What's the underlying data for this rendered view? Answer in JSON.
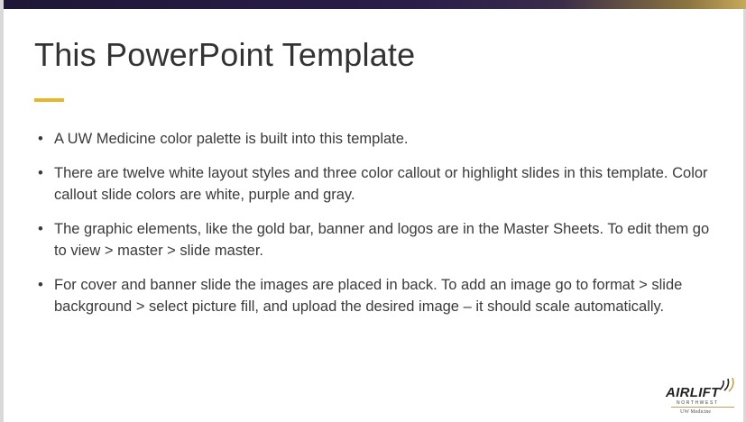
{
  "slide": {
    "title": "This PowerPoint Template",
    "bullet_char": "•",
    "bullets": [
      "A UW Medicine color palette is built into this template.",
      "There are twelve white layout styles and three color callout or highlight slides in this template. Color callout slide colors are white, purple and gray.",
      "The graphic elements, like the gold bar, banner and logos are in the Master Sheets. To edit them go to view > master > slide master.",
      "For cover and banner slide the images are placed in back. To add an image go to format > slide background > select picture fill, and upload the desired image – it should scale automatically."
    ]
  },
  "logo": {
    "wordmark": "AIRLIFT",
    "sub": "NORTHWEST",
    "tagline": "UW Medicine",
    "icon": "signal-waves-icon"
  },
  "colors": {
    "banner_purple": "#2a1d4a",
    "gold": "#e8b729",
    "title_text": "#333333",
    "body_text": "#3a3a3a"
  }
}
